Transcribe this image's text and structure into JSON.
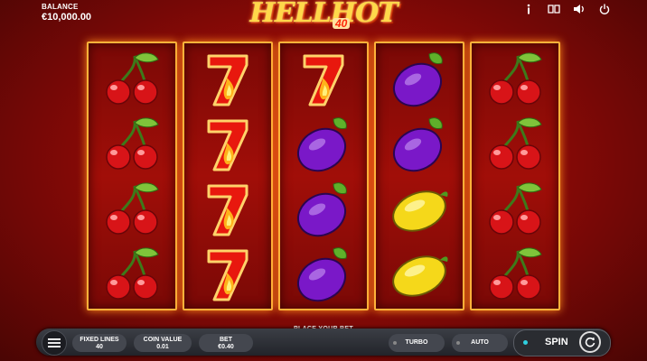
{
  "balance": {
    "label": "BALANCE",
    "value": "€10,000.00"
  },
  "top_icons": [
    "info-icon",
    "paytable-icon",
    "sound-icon",
    "power-icon"
  ],
  "logo": {
    "title": "HELLHOT",
    "subtitle": "40"
  },
  "reels": [
    [
      "cherry",
      "cherry",
      "cherry",
      "cherry"
    ],
    [
      "seven",
      "seven",
      "seven",
      "seven"
    ],
    [
      "seven",
      "plum",
      "plum",
      "plum"
    ],
    [
      "plum",
      "plum",
      "lemon",
      "lemon"
    ],
    [
      "cherry",
      "cherry",
      "cherry",
      "cherry"
    ]
  ],
  "message": "PLACE YOUR BET",
  "controls": {
    "fixed_lines_label": "FIXED LINES",
    "fixed_lines_value": "40",
    "coin_value_label": "COIN VALUE",
    "coin_value_value": "0.01",
    "bet_label": "BET",
    "bet_value": "€0.40",
    "turbo_label": "TURBO",
    "auto_label": "AUTO",
    "spin_label": "SPIN"
  },
  "colors": {
    "reel_border": "#ffb23a",
    "background": "#a10e08",
    "spin_indicator": "#2fd0e0"
  }
}
